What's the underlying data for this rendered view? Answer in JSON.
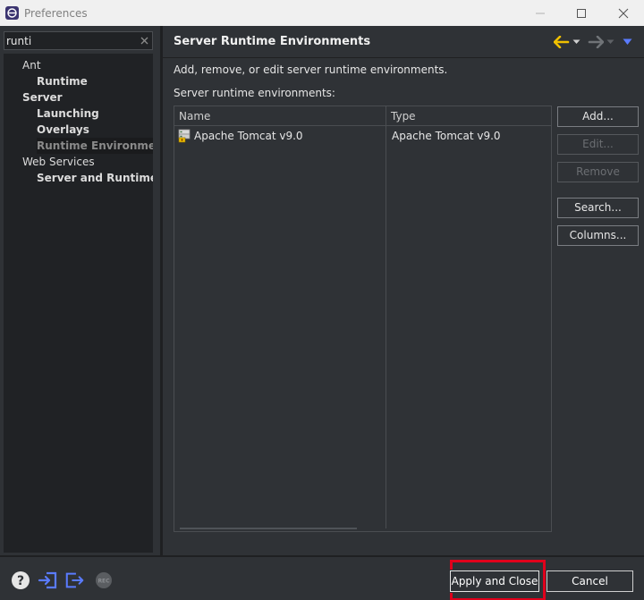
{
  "window": {
    "title": "Preferences"
  },
  "filter": {
    "value": "runti"
  },
  "tree": [
    {
      "label": "Ant",
      "level": 0
    },
    {
      "label": "Runtime",
      "level": 1
    },
    {
      "label": "Server",
      "level": 0,
      "bold": true
    },
    {
      "label": "Launching",
      "level": 1
    },
    {
      "label": "Overlays",
      "level": 1
    },
    {
      "label": "Runtime Environments",
      "level": 1,
      "selected": true
    },
    {
      "label": "Web Services",
      "level": 0
    },
    {
      "label": "Server and Runtime",
      "level": 1
    }
  ],
  "page": {
    "title": "Server Runtime Environments",
    "description": "Add, remove, or edit server runtime environments.",
    "list_label": "Server runtime environments:"
  },
  "table": {
    "columns": [
      "Name",
      "Type"
    ],
    "rows": [
      {
        "name": "Apache Tomcat v9.0",
        "type": "Apache Tomcat v9.0"
      }
    ]
  },
  "buttons": {
    "add": "Add...",
    "edit": "Edit...",
    "remove": "Remove",
    "search": "Search...",
    "columns": "Columns...",
    "apply_close": "Apply and Close",
    "cancel": "Cancel"
  },
  "icons": {
    "help": "help-icon",
    "import": "import-icon",
    "export": "export-icon",
    "record": "record-icon"
  },
  "colors": {
    "accent_blue": "#5a7bff",
    "nav_yellow": "#f0c000",
    "highlight_red": "#e0001b"
  }
}
